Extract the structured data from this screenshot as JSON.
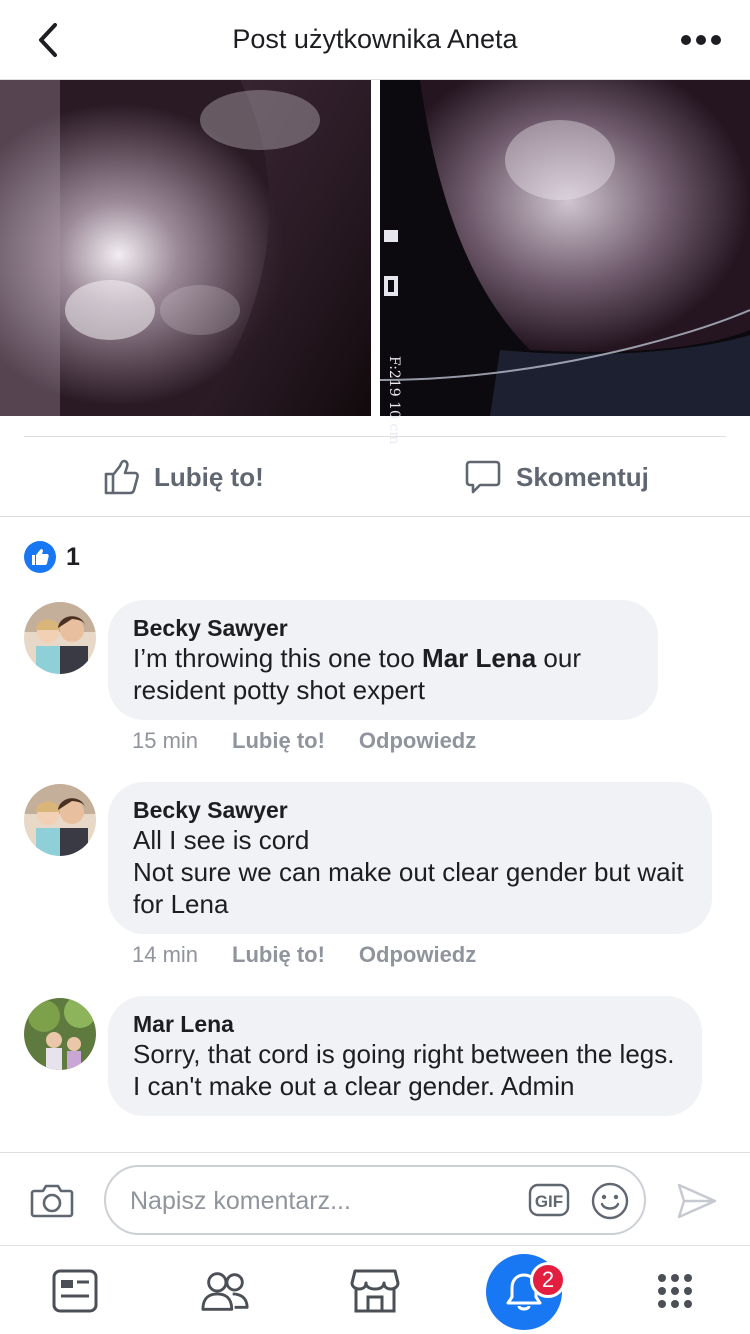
{
  "header": {
    "title": "Post użytkownika Aneta",
    "back_icon": "chevron-left-icon",
    "more_icon": "more-dots-icon"
  },
  "photos": {
    "right_overlay_text": "F:219  10 cm"
  },
  "actions": {
    "like_label": "Lubię to!",
    "comment_label": "Skomentuj"
  },
  "reactions": {
    "count": "1"
  },
  "comments": [
    {
      "author": "Becky Sawyer",
      "text_before": "I’m throwing this one too ",
      "mention": "Mar Lena",
      "text_after": " our resident potty shot expert",
      "time": "15 min",
      "like": "Lubię to!",
      "reply": "Odpowiedz"
    },
    {
      "author": "Becky Sawyer",
      "line1": "All I see is cord",
      "line2": "Not sure we can make out clear gender but wait for Lena",
      "time": "14 min",
      "like": "Lubię to!",
      "reply": "Odpowiedz"
    },
    {
      "author": "Mar Lena",
      "text": "Sorry, that cord is going right between the legs. I can't make out a clear gender. Admin"
    }
  ],
  "composer": {
    "placeholder": "Napisz komentarz...",
    "gif_label": "GIF"
  },
  "tabbar": {
    "notifications_badge": "2"
  },
  "colors": {
    "accent": "#1877f2",
    "badge": "#e41e3f",
    "bubble": "#f0f2f5",
    "muted": "#90949c"
  }
}
